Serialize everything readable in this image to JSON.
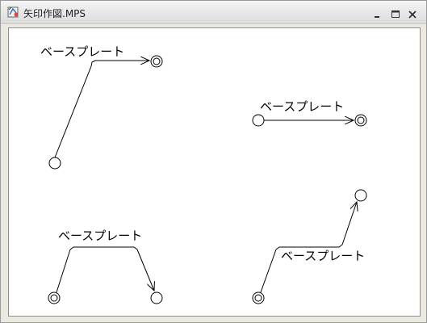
{
  "window": {
    "title": "矢印作図.MPS",
    "controls": {
      "minimize_icon": "minimize-icon",
      "maximize_icon": "maximize-icon",
      "close_icon": "close-icon"
    }
  },
  "drawing": {
    "stroke_color": "#000000",
    "arrows": [
      {
        "label": "ベースプレート",
        "start_marker": "single-circle",
        "end_marker": "double-circle"
      },
      {
        "label": "ベースプレート",
        "start_marker": "single-circle",
        "end_marker": "double-circle"
      },
      {
        "label": "ベースプレート",
        "start_marker": "double-circle",
        "end_marker": "single-circle"
      },
      {
        "label": "ベースプレート",
        "start_marker": "double-circle",
        "end_marker": "single-circle"
      }
    ]
  }
}
